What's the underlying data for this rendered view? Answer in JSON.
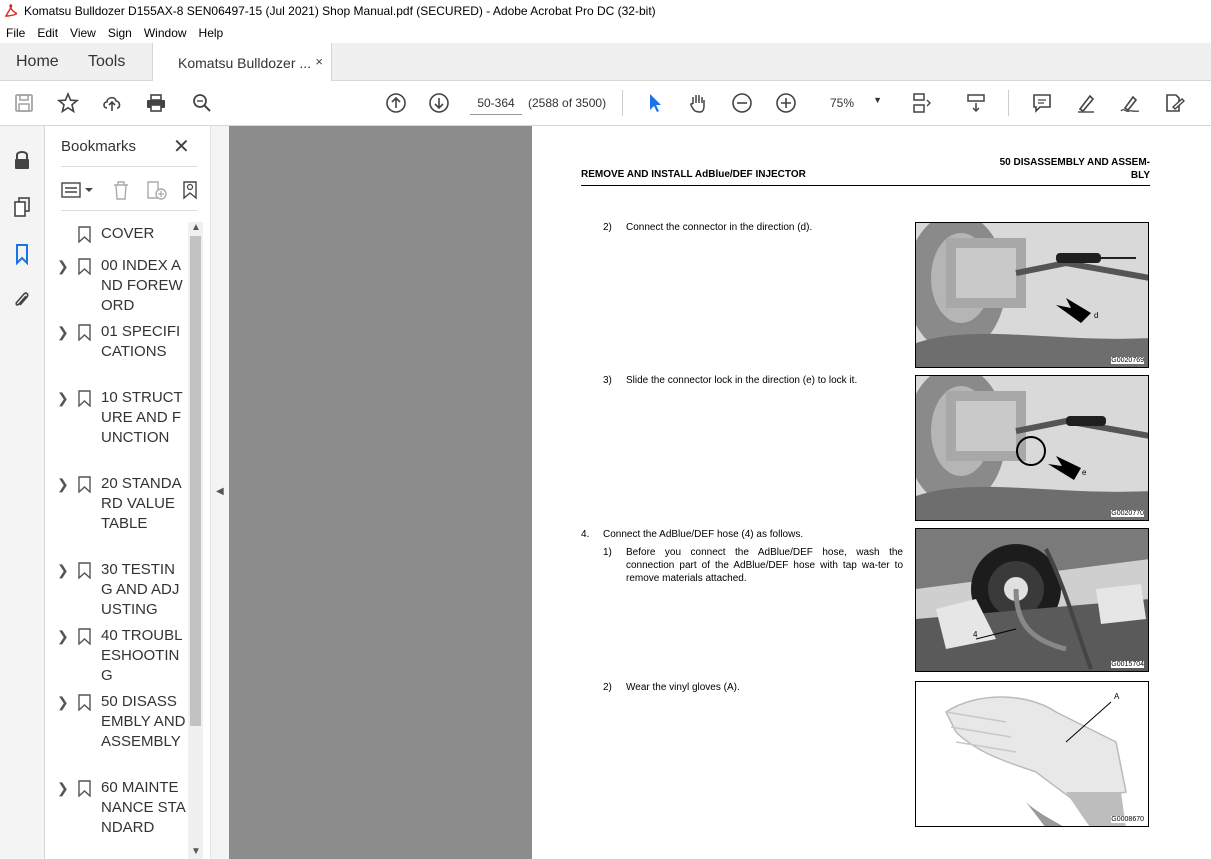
{
  "window": {
    "title": "Komatsu Bulldozer D155AX-8 SEN06497-15 (Jul 2021) Shop Manual.pdf (SECURED) - Adobe Acrobat Pro DC (32-bit)"
  },
  "menu": [
    "File",
    "Edit",
    "View",
    "Sign",
    "Window",
    "Help"
  ],
  "tabs": {
    "home": "Home",
    "tools": "Tools",
    "document": "Komatsu Bulldozer ...",
    "close": "×"
  },
  "toolbar": {
    "page_number": "50-364",
    "page_count": "(2588 of 3500)",
    "zoom": "75%",
    "zoom_caret": "▼"
  },
  "bookmarks": {
    "title": "Bookmarks",
    "close": "✕",
    "items": [
      {
        "label": "COVER",
        "expandable": false
      },
      {
        "label": " 00 INDEX AND FOREWORD",
        "expandable": true
      },
      {
        "label": " 01 SPECIFICATIONS",
        "expandable": true
      },
      {
        "label": " 10 STRUCTURE AND FUNCTION",
        "expandable": true
      },
      {
        "label": " 20 STANDARD VALUE TABLE",
        "expandable": true
      },
      {
        "label": " 30 TESTING AND ADJUSTING",
        "expandable": true
      },
      {
        "label": " 40 TROUBLESHOOTING",
        "expandable": true
      },
      {
        "label": " 50 DISASSEMBLY AND ASSEMBLY",
        "expandable": true
      },
      {
        "label": " 60 MAINTENANCE STANDARD",
        "expandable": true
      }
    ]
  },
  "document": {
    "header_left": "REMOVE AND INSTALL AdBlue/DEF INJECTOR",
    "header_right_1": "50 DISASSEMBLY AND ASSEM-",
    "header_right_2": "BLY",
    "steps": [
      {
        "num": "2)",
        "text": "Connect the connector in the direction (d)."
      },
      {
        "num": "3)",
        "text": "Slide the connector lock in the direction (e) to lock it."
      },
      {
        "num": "4.",
        "text": "Connect the AdBlue/DEF hose (4) as follows."
      },
      {
        "num": "1)",
        "text": "Before you connect the AdBlue/DEF hose, wash the connection part of the AdBlue/DEF hose with tap wa-ter to remove materials attached."
      },
      {
        "num": "2)",
        "text": "Wear the vinyl gloves (A)."
      }
    ],
    "figures": [
      {
        "id": "G0020769",
        "label": "d"
      },
      {
        "id": "G0020770",
        "label": "e"
      },
      {
        "id": "G0015704",
        "label": "4"
      },
      {
        "id": "G0008670",
        "label": "A"
      }
    ]
  }
}
